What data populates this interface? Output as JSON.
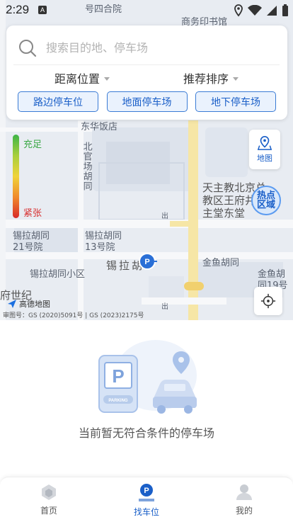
{
  "status_bar": {
    "time": "2:29",
    "notification_icon": "A"
  },
  "map": {
    "labels": [
      "号四合院",
      "商务印书馆",
      "东华饭店",
      "北官场胡同",
      "天主教北京总教区王府井天主堂东堂",
      "锡拉胡同21号院",
      "锡拉胡同13号院",
      "锡拉胡同小区",
      "锡拉胡",
      "金鱼胡同",
      "金鱼胡同19号院",
      "府世纪"
    ],
    "legend": {
      "top_label": "充足",
      "bottom_label": "紧张"
    },
    "map_button_label": "地图",
    "hot_zone_label": "热点区域",
    "amap_label": "高德地图",
    "copyright": "审图号：GS (2020)5091号 | GS (2023)2175号",
    "exit_label": "出"
  },
  "search": {
    "placeholder": "搜索目的地、停车场",
    "value": ""
  },
  "sorts": {
    "distance": "距离位置",
    "recommend": "推荐排序"
  },
  "filters": [
    "路边停车位",
    "地面停车场",
    "地下停车场"
  ],
  "empty_state": {
    "message": "当前暂无符合条件的停车场",
    "illustration_text": "PARKING"
  },
  "nav": {
    "items": [
      {
        "label": "首页"
      },
      {
        "label": "找车位"
      },
      {
        "label": "我的"
      }
    ],
    "active_index": 1
  },
  "colors": {
    "accent": "#1a5fc8",
    "congestion_free": "#3db447",
    "congestion_busy": "#d82a2a"
  }
}
